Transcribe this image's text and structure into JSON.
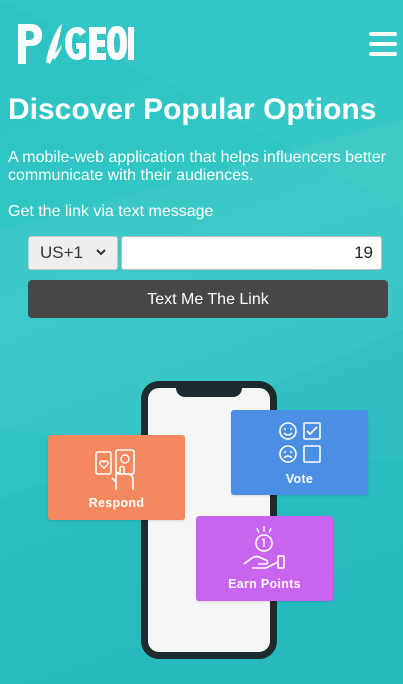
{
  "brand": {
    "logo_text": "PIGEON"
  },
  "header": {
    "menu_icon": "hamburger-menu-icon"
  },
  "hero": {
    "title": "Discover Popular Options",
    "subtitle": "A mobile-web application that helps influencers better communicate with their audiences.",
    "get_link_text": "Get the link via text message"
  },
  "form": {
    "country_code": "US+1",
    "phone_value": "19",
    "submit_label": "Text Me The Link"
  },
  "features": {
    "respond": {
      "label": "Respond",
      "icon": "touch-icon",
      "color": "#f4895f"
    },
    "vote": {
      "label": "Vote",
      "icon": "vote-faces-icon",
      "color": "#4a8fe3"
    },
    "earn": {
      "label": "Earn Points",
      "icon": "coin-hand-icon",
      "color": "#c964f0"
    }
  },
  "colors": {
    "background": "#2cc3c3",
    "button": "#474747"
  }
}
